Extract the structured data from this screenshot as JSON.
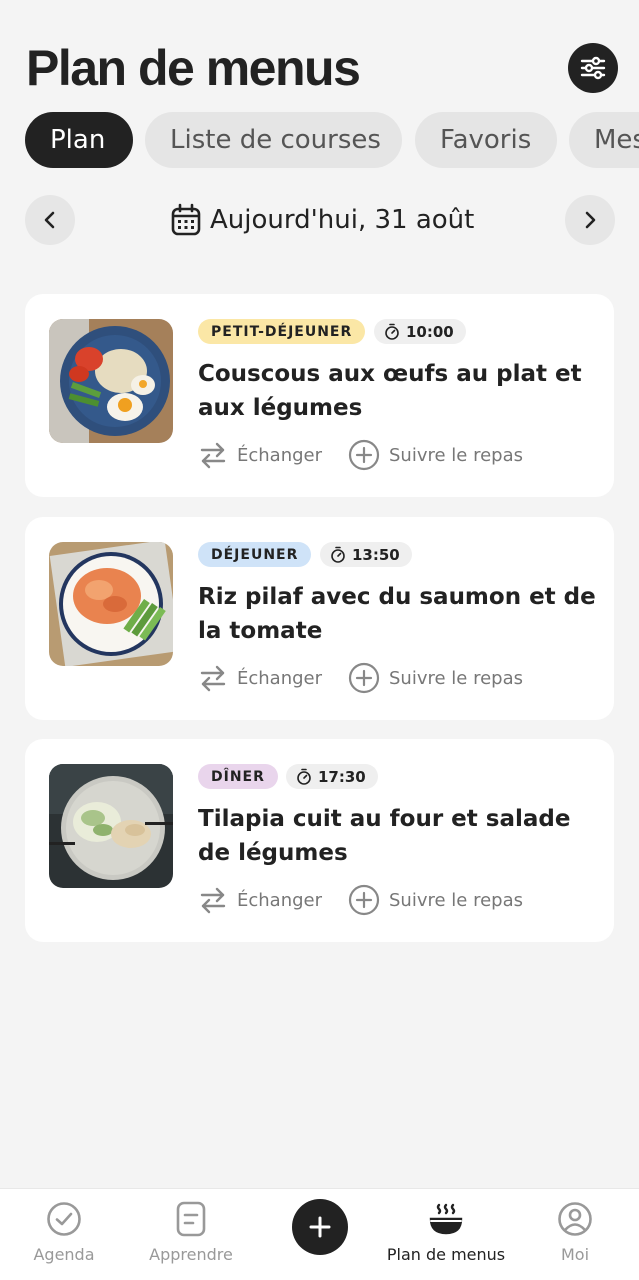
{
  "header": {
    "title": "Plan de menus"
  },
  "tabs": [
    {
      "label": "Plan"
    },
    {
      "label": "Liste de courses"
    },
    {
      "label": "Favoris"
    },
    {
      "label": "Mes"
    }
  ],
  "date_nav": {
    "label": "Aujourd'hui, 31 août"
  },
  "meals": [
    {
      "type": "PETIT-DÉJEUNER",
      "badge_color": "#fbe7a6",
      "time": "10:00",
      "title": "Couscous aux œufs au plat et aux légumes",
      "swap": "Échanger",
      "track": "Suivre le repas"
    },
    {
      "type": "DÉJEUNER",
      "badge_color": "#cfe3f8",
      "time": "13:50",
      "title": "Riz pilaf avec du saumon et de la tomate",
      "swap": "Échanger",
      "track": "Suivre le repas"
    },
    {
      "type": "DÎNER",
      "badge_color": "#e9d5ec",
      "time": "17:30",
      "title": "Tilapia cuit au four et salade de légumes",
      "swap": "Échanger",
      "track": "Suivre le repas"
    }
  ],
  "bottom_nav": {
    "items": [
      {
        "label": "Agenda",
        "icon": "check-circle-icon"
      },
      {
        "label": "Apprendre",
        "icon": "document-icon"
      },
      {
        "label": "Plan de menus",
        "icon": "bowl-icon"
      },
      {
        "label": "Moi",
        "icon": "user-icon"
      }
    ],
    "add_icon": "plus-icon"
  },
  "colors": {
    "dark": "#222222",
    "background": "#f4f4f4",
    "muted": "#777777"
  }
}
